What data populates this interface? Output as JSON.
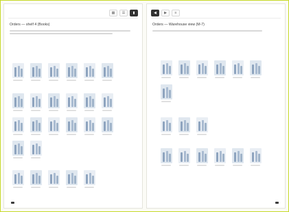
{
  "window": {
    "bg_accent": "#c6d927"
  },
  "left_page": {
    "breadcrumb": "",
    "title": "Orders — shelf 4 (Books)",
    "sections": [
      {
        "label": "",
        "accent": true
      }
    ],
    "toolbar_icons": [
      "grid-view-icon",
      "list-view-icon",
      "bookmark-icon"
    ],
    "footer_page": ""
  },
  "right_page": {
    "title": "Orders — Warehouse view (M-7)",
    "sections": [
      {
        "label": ""
      },
      {
        "label": ""
      },
      {
        "label": "",
        "accent": true
      }
    ],
    "toolbar_icons": [
      "back-icon",
      "forward-icon",
      "menu-icon"
    ],
    "footer_page": ""
  },
  "palette": {
    "thumb_bg": "#e9eef4",
    "thumb_bg_alt": "#dfe7ef"
  }
}
